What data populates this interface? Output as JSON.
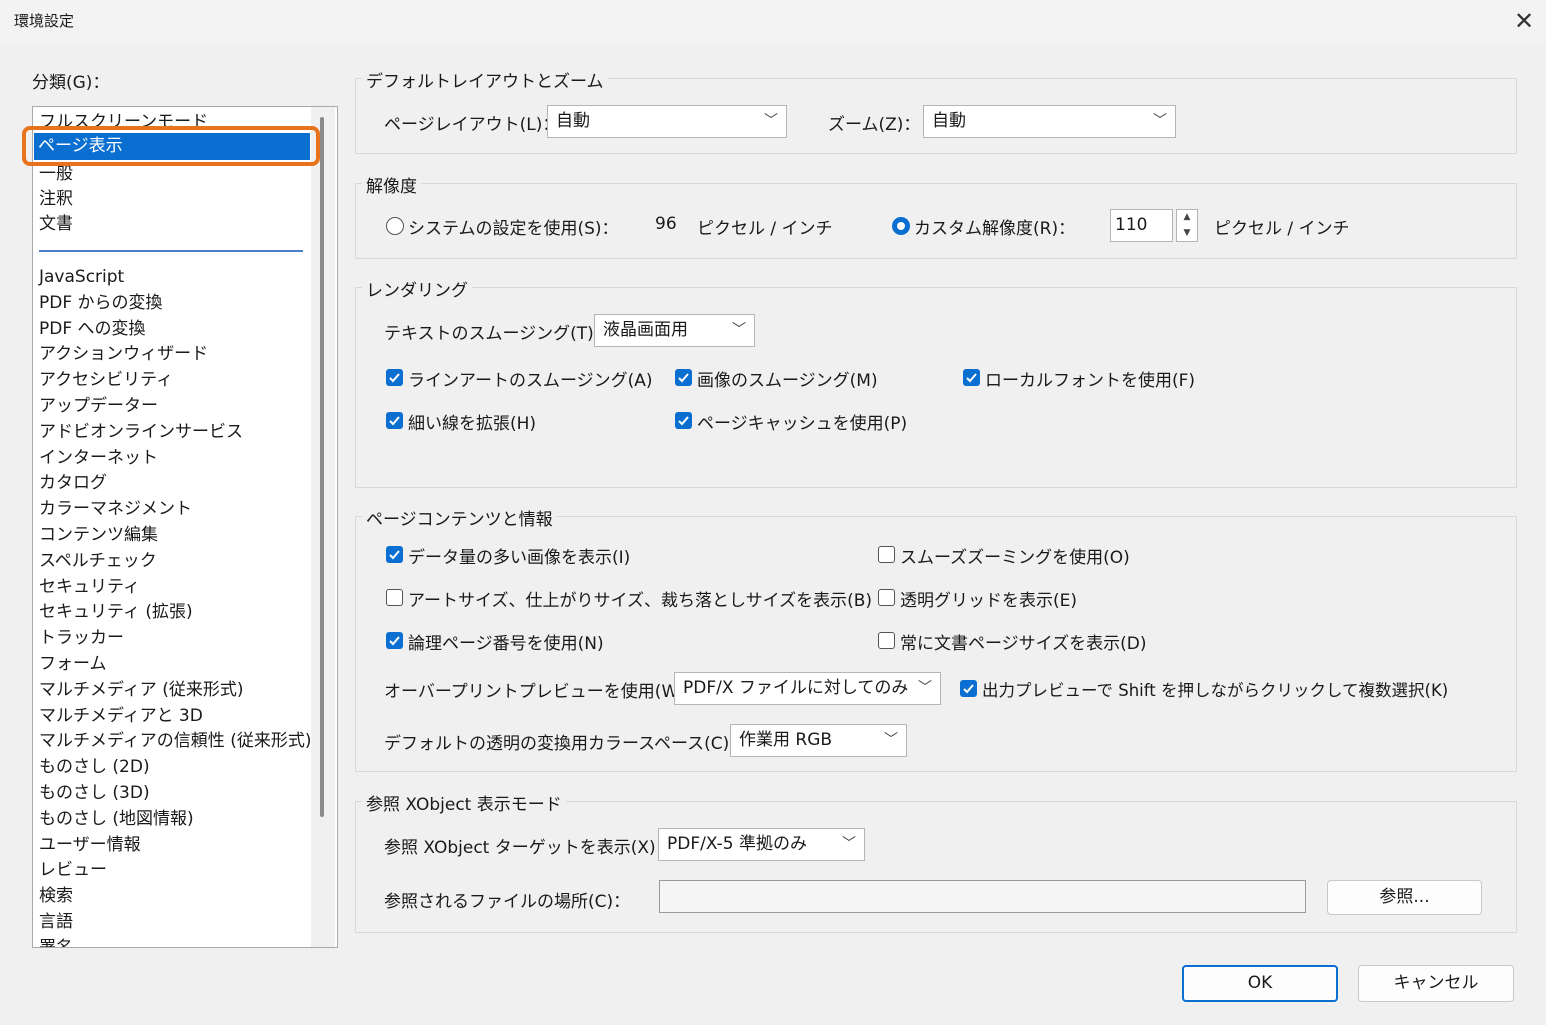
{
  "window": {
    "title": "環境設定",
    "close_glyph": "✕"
  },
  "category_label": "分類(G)：",
  "categories_top": [
    "フルスクリーンモード",
    "ページ表示",
    "一般",
    "注釈",
    "文書"
  ],
  "selected_category": "ページ表示",
  "categories": [
    "JavaScript",
    "PDF からの変換",
    "PDF への変換",
    "アクションウィザード",
    "アクセシビリティ",
    "アップデーター",
    "アドビオンラインサービス",
    "インターネット",
    "カタログ",
    "カラーマネジメント",
    "コンテンツ編集",
    "スペルチェック",
    "セキュリティ",
    "セキュリティ (拡張)",
    "トラッカー",
    "フォーム",
    "マルチメディア (従来形式)",
    "マルチメディアと 3D",
    "マルチメディアの信頼性 (従来形式)",
    "ものさし (2D)",
    "ものさし (3D)",
    "ものさし (地図情報)",
    "ユーザー情報",
    "レビュー",
    "検索",
    "言語",
    "署名"
  ],
  "layout_group": {
    "title": "デフォルトレイアウトとズーム",
    "page_layout_label": "ページレイアウト(L)：",
    "page_layout_value": "自動",
    "zoom_label": "ズーム(Z)：",
    "zoom_value": "自動"
  },
  "resolution_group": {
    "title": "解像度",
    "system_label": "システムの設定を使用(S)：",
    "system_value": "96",
    "unit1": "ピクセル / インチ",
    "custom_label": "カスタム解像度(R)：",
    "custom_value": "110",
    "unit2": "ピクセル / インチ"
  },
  "rendering_group": {
    "title": "レンダリング",
    "text_smoothing_label": "テキストのスムージング(T)：",
    "text_smoothing_value": "液晶画面用",
    "line_art": "ラインアートのスムージング(A)",
    "image_smoothing": "画像のスムージング(M)",
    "local_fonts": "ローカルフォントを使用(F)",
    "thin_lines": "細い線を拡張(H)",
    "page_cache": "ページキャッシュを使用(P)"
  },
  "content_group": {
    "title": "ページコンテンツと情報",
    "large_images": "データ量の多い画像を表示(I)",
    "smooth_zoom": "スムーズズーミングを使用(O)",
    "art_trim": "アートサイズ、仕上がりサイズ、裁ち落としサイズを表示(B)",
    "transparency_grid": "透明グリッドを表示(E)",
    "logical_page": "論理ページ番号を使用(N)",
    "doc_page_size": "常に文書ページサイズを表示(D)",
    "overprint_label": "オーバープリントプレビューを使用(W)：",
    "overprint_value": "PDF/X ファイルに対してのみ",
    "output_preview": "出力プレビューで Shift を押しながらクリックして複数選択(K)",
    "blend_label": "デフォルトの透明の変換用カラースペース(C)：",
    "blend_value": "作業用 RGB"
  },
  "xobject_group": {
    "title": "参照 XObject 表示モード",
    "target_label": "参照 XObject ターゲットを表示(X)：",
    "target_value": "PDF/X-5 準拠のみ",
    "location_label": "参照されるファイルの場所(C)：",
    "location_value": "",
    "browse_label": "参照..."
  },
  "buttons": {
    "ok": "OK",
    "cancel": "キャンセル"
  },
  "colors": {
    "accent": "#0a6fd0",
    "highlight": "#e8731d"
  }
}
